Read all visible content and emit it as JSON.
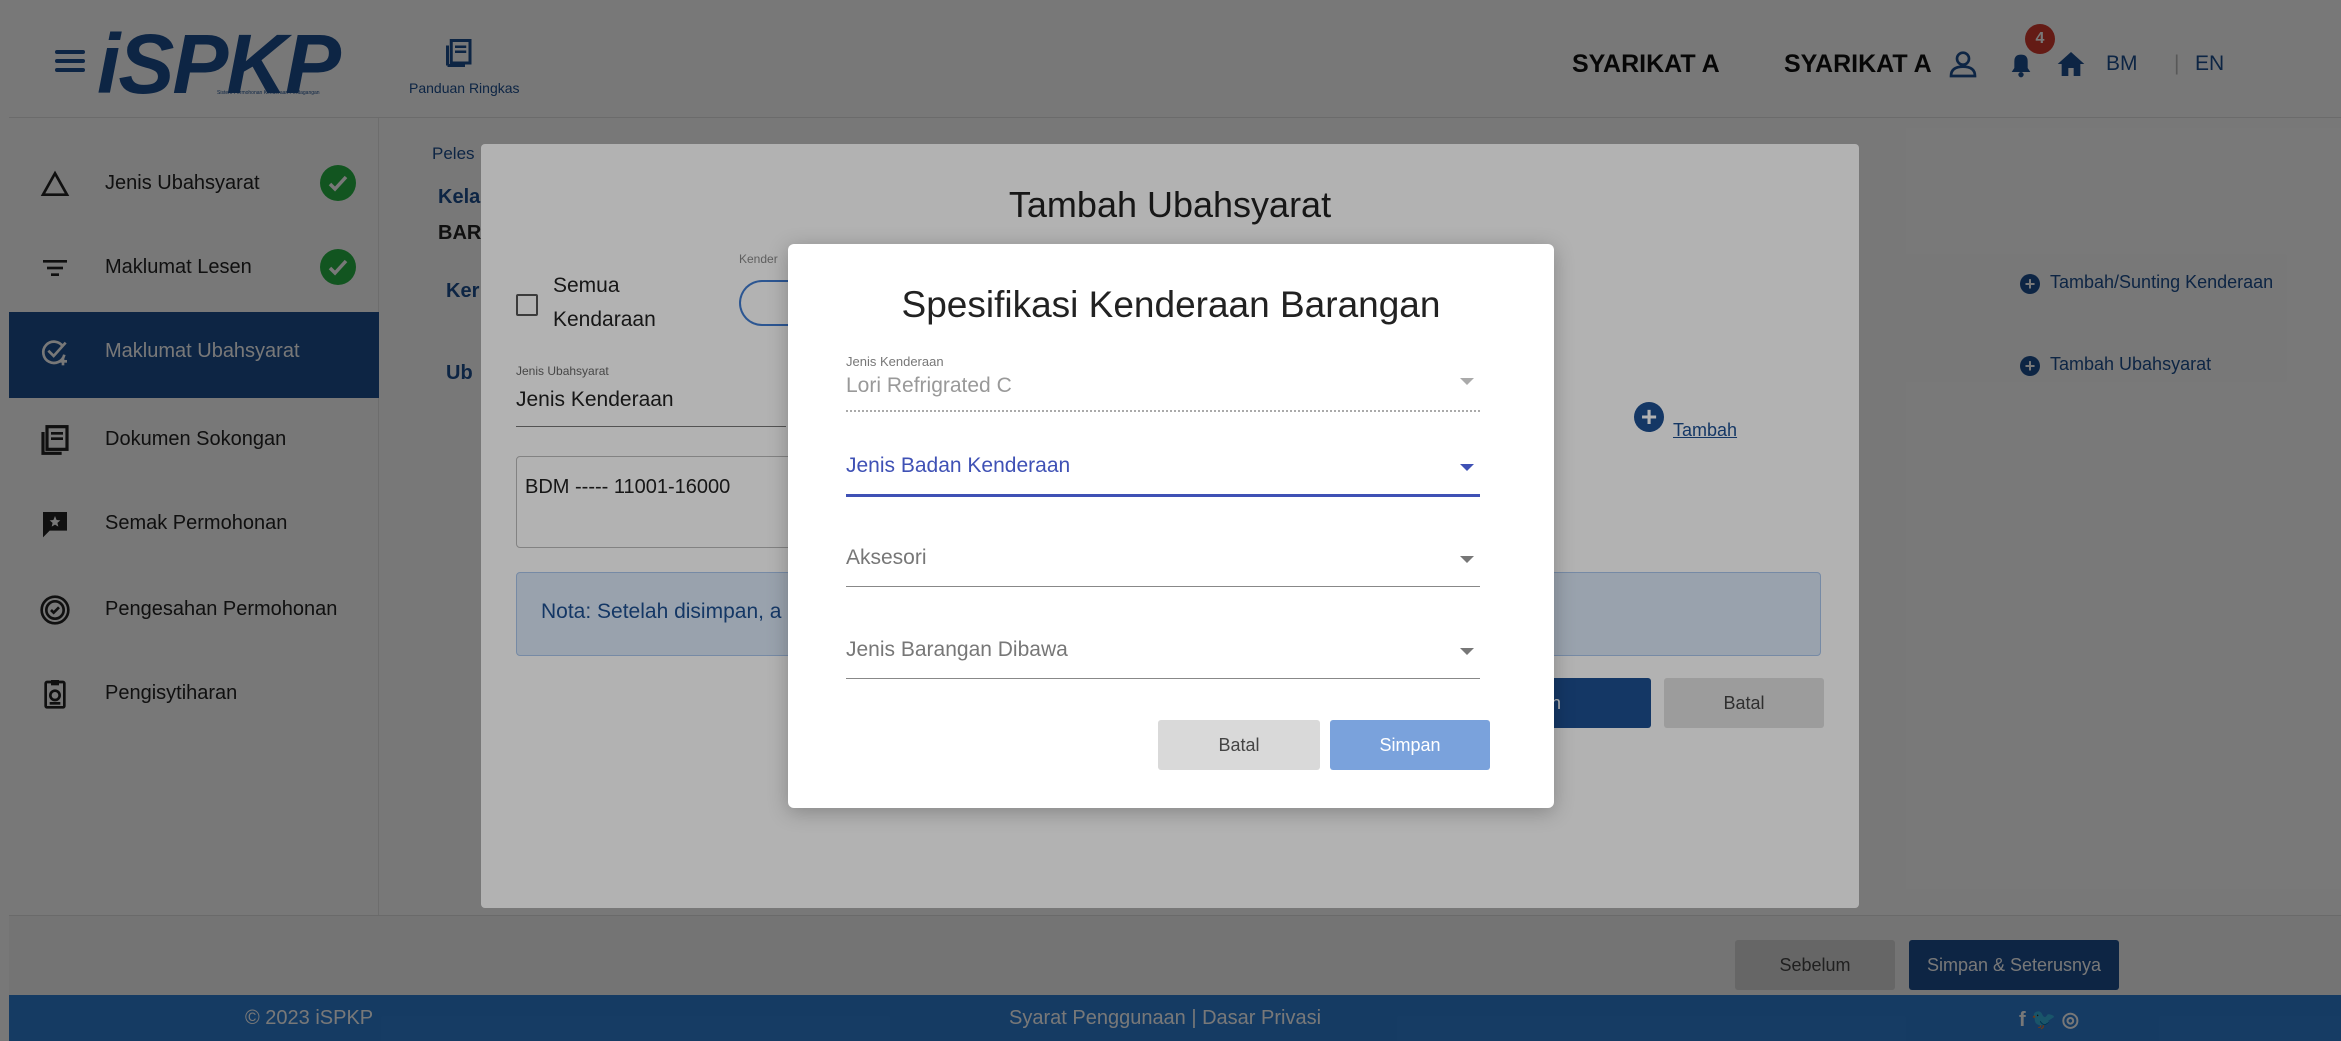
{
  "header": {
    "logo_text": "iSPKP",
    "logo_subtitle": "Sistem Permohonan Kenderaan Perdagangan",
    "guide_label": "Panduan Ringkas",
    "company_1": "SYARIKAT A",
    "company_2": "SYARIKAT A",
    "notification_count": "4",
    "lang_bm": "BM",
    "lang_sep": "|",
    "lang_en": "EN"
  },
  "sidebar": {
    "items": [
      {
        "label": "Jenis Ubahsyarat",
        "icon": "triangle-icon",
        "completed": true
      },
      {
        "label": "Maklumat Lesen",
        "icon": "filter-icon",
        "completed": true
      },
      {
        "label": "Maklumat Ubahsyarat",
        "icon": "edit-check-icon",
        "active": true
      },
      {
        "label": "Dokumen Sokongan",
        "icon": "document-icon"
      },
      {
        "label": "Semak Permohonan",
        "icon": "chat-star-icon"
      },
      {
        "label": "Pengesahan Permohonan",
        "icon": "badge-check-icon"
      },
      {
        "label": "Pengisytiharan",
        "icon": "clipboard-icon"
      }
    ]
  },
  "main": {
    "frag_peles": "Peles",
    "frag_kela": "Kela",
    "frag_bar": "BAR",
    "frag_ker": "Ker",
    "frag_ub": "Ub",
    "right_link_1": "Tambah/Sunting Kenderaan",
    "right_link_2": "Tambah Ubahsyarat"
  },
  "dialog_back": {
    "title": "Tambah Ubahsyarat",
    "checkbox_label_line1": "Semua",
    "checkbox_label_line2": "Kendaraan",
    "kenderaan_label_frag": "Kender",
    "jenis_ubahsyarat_label": "Jenis Ubahsyarat",
    "jenis_ubahsyarat_value": "Jenis Kenderaan",
    "vehicle_entry": "BDM ----- 11001-16000",
    "nota_text": "Nota: Setelah disimpan, a",
    "tambah_link": "Tambah",
    "simpan_frag": "pan",
    "batal_label": "Batal"
  },
  "dialog_front": {
    "title": "Spesifikasi Kenderaan Barangan",
    "fields": [
      {
        "label": "Jenis Kenderaan",
        "value": "Lori Refrigrated C",
        "state": "disabled"
      },
      {
        "label": "",
        "value": "Jenis Badan Kenderaan",
        "state": "focused"
      },
      {
        "label": "",
        "value": "Aksesori",
        "state": "default"
      },
      {
        "label": "",
        "value": "Jenis Barangan Dibawa",
        "state": "default"
      }
    ],
    "batal_label": "Batal",
    "simpan_label": "Simpan"
  },
  "bottom": {
    "sebelum_label": "Sebelum",
    "next_label": "Simpan & Seterusnya"
  },
  "footer": {
    "copyright": "© 2023 iSPKP",
    "links": "Syarat Penggunaan | Dasar Privasi",
    "social": "f 🐦 ◎"
  },
  "colors": {
    "primary": "#1d4f91",
    "footer": "#2f7ed3",
    "success": "#28b446",
    "badge": "#d53b2f",
    "focus": "#3f51b5",
    "nota_bg": "#dce9f8"
  }
}
